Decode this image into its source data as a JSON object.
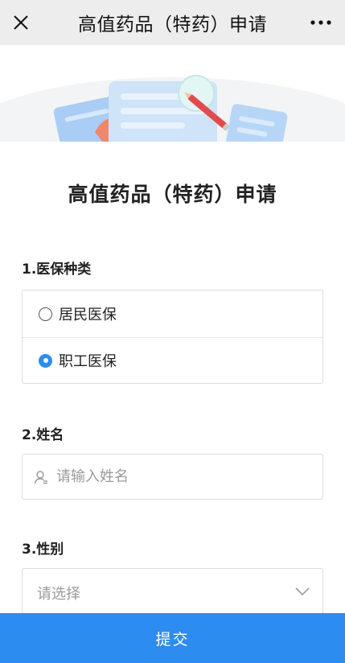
{
  "navbar": {
    "title": "高值药品（特药）申请",
    "close_icon": "close-icon",
    "more_icon": "more-icon"
  },
  "banner": {
    "illustration": "document-pen-illustration"
  },
  "form": {
    "title": "高值药品（特药）申请",
    "q1": {
      "label": "1.医保种类",
      "options": [
        "居民医保",
        "职工医保"
      ],
      "selected": "职工医保"
    },
    "q2": {
      "label": "2.姓名",
      "placeholder": "请输入姓名",
      "value": "",
      "icon": "user-icon"
    },
    "q3": {
      "label": "3.性别",
      "placeholder": "请选择",
      "icon": "chevron-down-icon"
    },
    "submit_label": "提交"
  },
  "colors": {
    "accent": "#2d8cf0",
    "navbar_bg": "#ededed",
    "border": "#dcdcdc",
    "placeholder": "#9a9a9a"
  }
}
